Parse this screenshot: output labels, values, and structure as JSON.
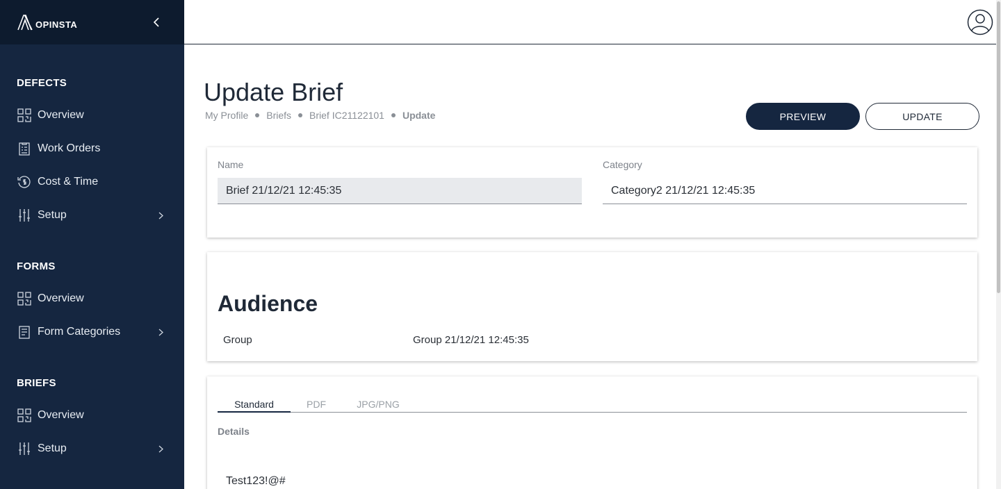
{
  "app": {
    "logo_text": "OPINSTA"
  },
  "sidebar": {
    "sections": [
      {
        "title": "DEFECTS",
        "items": [
          {
            "label": "Overview",
            "icon": "grid-icon"
          },
          {
            "label": "Work Orders",
            "icon": "clipboard-icon"
          },
          {
            "label": "Cost & Time",
            "icon": "clock-dollar-icon"
          },
          {
            "label": "Setup",
            "icon": "sliders-icon",
            "has_submenu": true
          }
        ]
      },
      {
        "title": "FORMS",
        "items": [
          {
            "label": "Overview",
            "icon": "grid-icon"
          },
          {
            "label": "Form Categories",
            "icon": "document-icon",
            "has_submenu": true
          }
        ]
      },
      {
        "title": "BRIEFS",
        "items": [
          {
            "label": "Overview",
            "icon": "grid-icon"
          },
          {
            "label": "Setup",
            "icon": "sliders-icon",
            "has_submenu": true
          }
        ]
      }
    ]
  },
  "page": {
    "title": "Update Brief",
    "breadcrumb": [
      "My Profile",
      "Briefs",
      "Brief IC21122101",
      "Update"
    ],
    "actions": {
      "preview_label": "PREVIEW",
      "update_label": "UPDATE"
    }
  },
  "brief_form": {
    "name_label": "Name",
    "name_value": "Brief 21/12/21 12:45:35",
    "category_label": "Category",
    "category_value": "Category2 21/12/21 12:45:35"
  },
  "audience": {
    "title": "Audience",
    "group_label": "Group",
    "group_value": "Group 21/12/21 12:45:35"
  },
  "content": {
    "tabs": [
      "Standard",
      "PDF",
      "JPG/PNG"
    ],
    "active_tab": "Standard",
    "details_label": "Details",
    "details_value": "Test123!@#"
  },
  "colors": {
    "sidebar_bg": "#152640",
    "logo_bar_bg": "#0d1b2e",
    "primary": "#152640"
  }
}
